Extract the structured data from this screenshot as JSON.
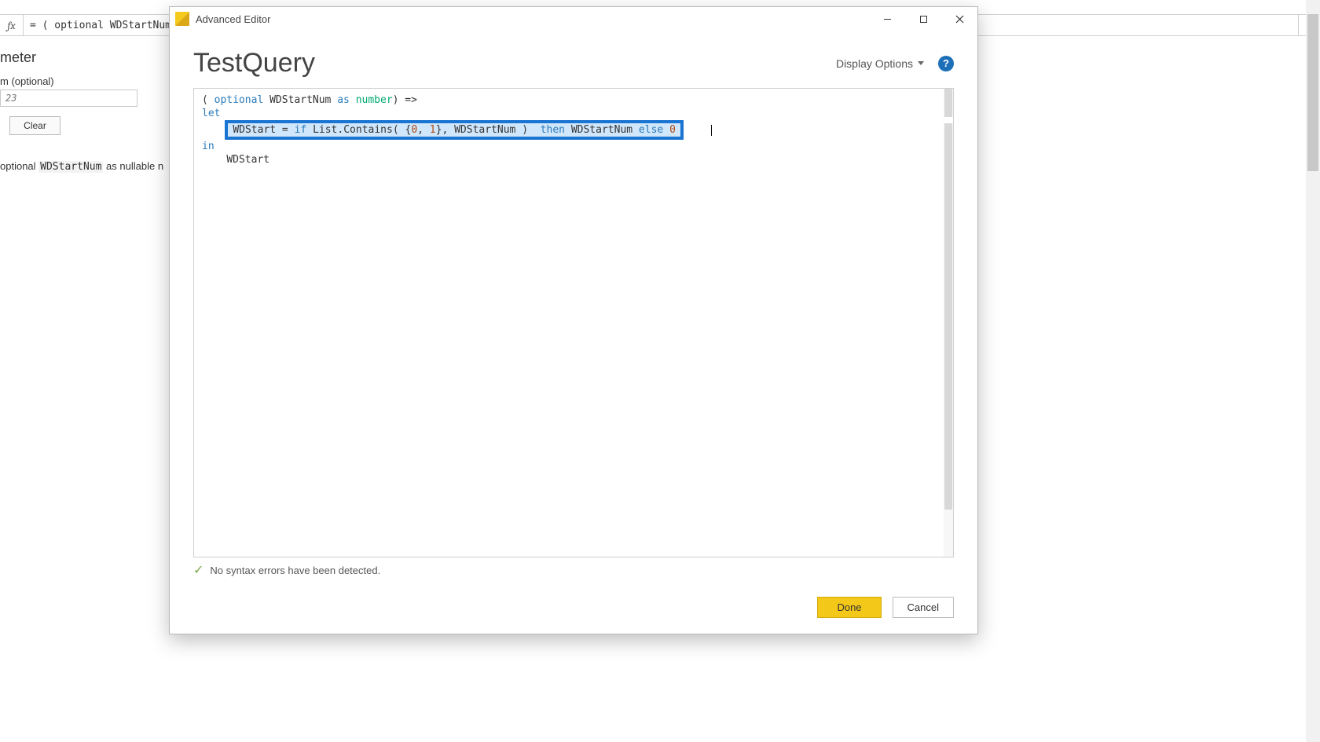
{
  "background": {
    "formula_bar": "= ( optional WDStartNum a",
    "panel_title": "meter",
    "param_label": "m (optional)",
    "param_placeholder": "23",
    "clear_label": "Clear",
    "description_prefix": "optional ",
    "description_code": "WDStartNum",
    "description_suffix": " as nullable n"
  },
  "modal": {
    "title": "Advanced Editor",
    "query_name": "TestQuery",
    "display_options_label": "Display Options",
    "code": {
      "line1_prefix": "( ",
      "line1_kw1": "optional",
      "line1_mid": " WDStartNum ",
      "line1_kw2": "as",
      "line1_space": " ",
      "line1_type": "number",
      "line1_suffix": ") =>",
      "line2": "let",
      "indent": "    ",
      "hl_part1": "WDStart = ",
      "hl_kw_if": "if",
      "hl_part2": " List.Contains( {",
      "hl_num0": "0",
      "hl_comma": ", ",
      "hl_num1": "1",
      "hl_part3": "}, WDStartNum )  ",
      "hl_kw_then": "then",
      "hl_part4": " WDStartNum ",
      "hl_kw_else": "else",
      "hl_space": " ",
      "hl_numend": "0",
      "line4": "in",
      "line5": "WDStart"
    },
    "status": "No syntax errors have been detected.",
    "done_label": "Done",
    "cancel_label": "Cancel"
  }
}
